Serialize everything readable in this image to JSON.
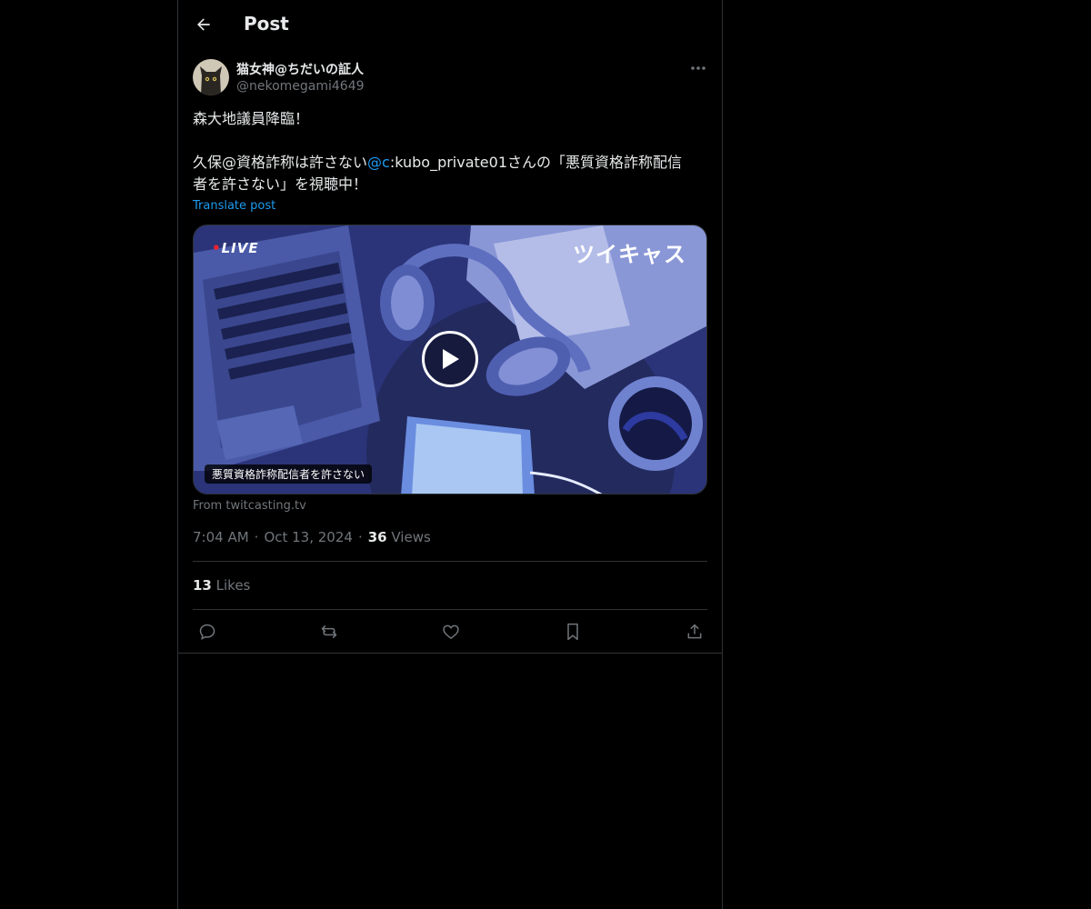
{
  "header": {
    "title": "Post"
  },
  "post": {
    "author_name": "猫女神@ちだいの証人",
    "author_handle": "@nekomegami4649",
    "line1": "森大地議員降臨！",
    "line2_before": "久保@資格詐称は許さない",
    "line2_mention": "@c",
    "line2_after": ":kubo_private01さんの「悪質資格詐称配信",
    "line3": "者を許さない」を視聴中！",
    "translate_label": "Translate post",
    "media": {
      "live_label": "LIVE",
      "brand_label": "ツイキャス",
      "caption": "悪質資格詐称配信者を許さない",
      "source": "From twitcasting.tv"
    },
    "time": "7:04 AM",
    "date": "Oct 13, 2024",
    "views_count": "36",
    "views_label": "Views",
    "likes_count": "13",
    "likes_label": "Likes"
  },
  "icons": {
    "back": "arrow-left-icon",
    "more": "more-horizontal-icon",
    "reply": "reply-icon",
    "repost": "repost-icon",
    "like": "heart-icon",
    "bookmark": "bookmark-icon",
    "share": "share-icon"
  },
  "colors": {
    "background": "#000000",
    "text": "#e7e9ea",
    "muted": "#71767b",
    "accent": "#1d9bf0",
    "border": "#2f3336",
    "live": "#f4212e"
  }
}
